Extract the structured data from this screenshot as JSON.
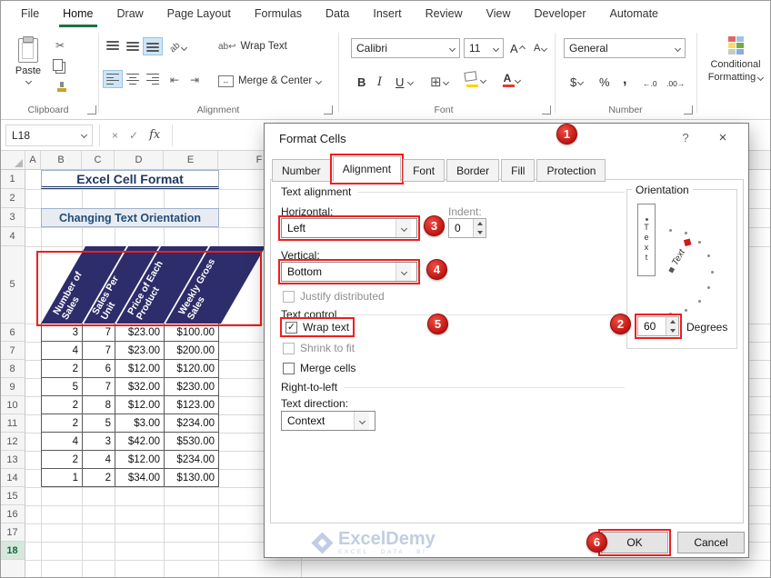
{
  "ribbon": {
    "tabs": [
      "File",
      "Home",
      "Draw",
      "Page Layout",
      "Formulas",
      "Data",
      "Insert",
      "Review",
      "View",
      "Developer",
      "Automate"
    ],
    "active_tab": "Home",
    "clipboard": {
      "group_label": "Clipboard",
      "paste_label": "Paste"
    },
    "alignment": {
      "group_label": "Alignment",
      "wrap_text_label": "Wrap Text",
      "merge_center_label": "Merge & Center"
    },
    "font": {
      "group_label": "Font",
      "font_name": "Calibri",
      "font_size": "11",
      "grow_label": "A",
      "shrink_label": "A",
      "bold": "B",
      "italic": "I",
      "underline": "U",
      "border_glyph": "⊞"
    },
    "number": {
      "group_label": "Number",
      "format": "General",
      "currency": "$",
      "percent": "%",
      "comma": ",",
      "inc_decimal": "←.0",
      "dec_decimal": ".00→"
    },
    "styles": {
      "conditional_line1": "Conditional",
      "conditional_line2": "Formatting"
    }
  },
  "formula_bar": {
    "name_box": "L18",
    "cancel": "×",
    "enter": "✓",
    "fx": "fx"
  },
  "sheet": {
    "col_headers": [
      "A",
      "B",
      "C",
      "D",
      "E",
      "F"
    ],
    "row_headers": [
      "1",
      "2",
      "3",
      "4",
      "5",
      "6",
      "7",
      "8",
      "9",
      "10",
      "11",
      "12",
      "13",
      "14",
      "15",
      "16",
      "17",
      "18"
    ],
    "title": "Excel Cell Format",
    "subtitle": "Changing Text Orientation",
    "table": {
      "headers": [
        "Number of\nSales",
        "Sales Per\nUnit",
        "Price of Each\nProduct",
        "Weekly Gross\nSales"
      ],
      "rows": [
        [
          "3",
          "7",
          "$23.00",
          "$100.00"
        ],
        [
          "4",
          "7",
          "$23.00",
          "$200.00"
        ],
        [
          "2",
          "6",
          "$12.00",
          "$120.00"
        ],
        [
          "5",
          "7",
          "$32.00",
          "$230.00"
        ],
        [
          "2",
          "8",
          "$12.00",
          "$123.00"
        ],
        [
          "2",
          "5",
          "$3.00",
          "$234.00"
        ],
        [
          "4",
          "3",
          "$42.00",
          "$530.00"
        ],
        [
          "2",
          "4",
          "$12.00",
          "$234.00"
        ],
        [
          "1",
          "2",
          "$34.00",
          "$130.00"
        ]
      ]
    }
  },
  "dialog": {
    "title": "Format Cells",
    "help": "?",
    "close": "×",
    "tabs": [
      "Number",
      "Alignment",
      "Font",
      "Border",
      "Fill",
      "Protection"
    ],
    "active_tab": "Alignment",
    "text_alignment": {
      "group": "Text alignment",
      "horizontal_label": "Horizontal:",
      "horizontal_value": "Left",
      "indent_label": "Indent:",
      "indent_value": "0",
      "vertical_label": "Vertical:",
      "vertical_value": "Bottom",
      "justify": "Justify distributed"
    },
    "text_control": {
      "group": "Text control",
      "wrap": "Wrap text",
      "shrink": "Shrink to fit",
      "merge": "Merge cells"
    },
    "rtl": {
      "group": "Right-to-left",
      "direction_label": "Text direction:",
      "direction_value": "Context"
    },
    "orientation": {
      "group": "Orientation",
      "text_vertical": "Text",
      "needle_text": "Text",
      "degrees_value": "60",
      "degrees_label": "Degrees"
    },
    "ok": "OK",
    "cancel": "Cancel"
  },
  "annotations": {
    "b1": "1",
    "b2": "2",
    "b3": "3",
    "b4": "4",
    "b5": "5",
    "b6": "6"
  },
  "watermark": {
    "brand": "ExcelDemy",
    "tagline": "EXCEL · DATA · BI"
  },
  "colors": {
    "excel_green": "#1e7145",
    "table_header_fill": "#2d2d6b",
    "annotation_red": "#f21d1d",
    "title_navy": "#1f3864",
    "subtitle_blue": "#1f4e79"
  }
}
